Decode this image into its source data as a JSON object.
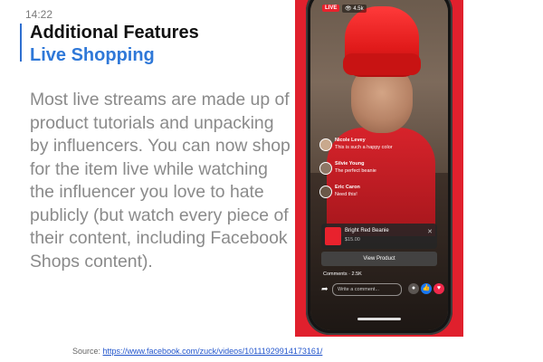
{
  "status": {
    "time": "14:22"
  },
  "header": {
    "title": "Additional Features",
    "subtitle": "Live Shopping"
  },
  "body": {
    "paragraph": "Most live streams are made up of product tutorials and unpacking by influencers. You can now shop for the item live while watching the influencer you love to hate publicly (but watch every piece of their content, including Facebook Shops content)."
  },
  "source": {
    "label": "Source: ",
    "url": "https://www.facebook.com/zuck/videos/10111929914173161/"
  },
  "phone": {
    "live_badge": "LIVE",
    "viewers": "4.5k",
    "comments": [
      {
        "name": "Nicole Levey",
        "text": "This is such a happy color"
      },
      {
        "name": "Silvie Young",
        "text": "The perfect beanie"
      },
      {
        "name": "Eric Caron",
        "text": "Need this!"
      }
    ],
    "product": {
      "name": "Bright Red Beanie",
      "price": "$15.00"
    },
    "view_button": "View Product",
    "comments_count": "Comments · 2.5K",
    "comment_placeholder": "Write a comment..."
  },
  "colors": {
    "accent": "#2f78d8",
    "brand_red": "#e0202d",
    "body_text": "#8a8a8a"
  }
}
